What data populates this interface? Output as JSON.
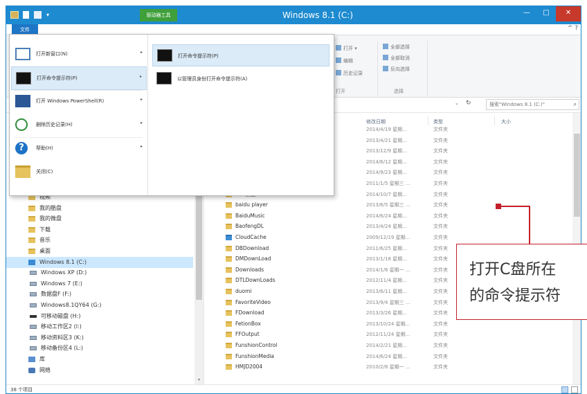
{
  "titlebar": {
    "title": "Windows 8.1 (C:)",
    "contextual_tab": "驱动器工具",
    "qat_more": "▾",
    "minimize": "—",
    "maximize": "□",
    "close": "✕"
  },
  "tabs": {
    "file": "文件",
    "ribbon_controls": "^ ?"
  },
  "ribbon": {
    "open": "打开 ▾",
    "edit": "编辑",
    "history": "历史记录",
    "select_all": "全部选择",
    "select_none": "全部取消",
    "invert": "反向选择",
    "group_open": "打开",
    "group_select": "选择"
  },
  "address": {
    "chevron": "⌄",
    "refresh": "↻",
    "search_placeholder": "搜索\"Windows 8.1 (C:)\"",
    "search_icon": "⌕"
  },
  "file_menu": {
    "items": [
      {
        "label": "打开新窗口(N)",
        "arrow": "▸",
        "icon": "window-icon"
      },
      {
        "label": "打开命令提示符(P)",
        "arrow": "▸",
        "icon": "command-prompt-icon"
      },
      {
        "label": "打开 Windows PowerShell(R)",
        "arrow": "▸",
        "icon": "powershell-icon"
      },
      {
        "label": "删除历史记录(H)",
        "arrow": "▸",
        "icon": "delete-history-icon"
      },
      {
        "label": "帮助(H)",
        "arrow": "▸",
        "icon": "help-icon"
      },
      {
        "label": "关闭(C)",
        "arrow": "",
        "icon": "close-folder-icon"
      }
    ],
    "submenu": [
      {
        "label": "打开命令提示符(P)",
        "icon": "command-prompt-icon"
      },
      {
        "label": "以管理员身份打开命令提示符(A)",
        "icon": "admin-command-prompt-icon"
      }
    ],
    "help_glyph": "?"
  },
  "nav": {
    "items": [
      {
        "label": "视频",
        "icon": "folder-icon"
      },
      {
        "label": "我的酷盘",
        "icon": "folder-icon"
      },
      {
        "label": "我的微盘",
        "icon": "folder-icon"
      },
      {
        "label": "下载",
        "icon": "folder-icon"
      },
      {
        "label": "音乐",
        "icon": "folder-icon"
      },
      {
        "label": "桌面",
        "icon": "folder-icon"
      },
      {
        "label": "Windows 8.1 (C:)",
        "icon": "windows-drive-icon",
        "selected": true
      },
      {
        "label": "Windows XP (D:)",
        "icon": "drive-icon"
      },
      {
        "label": "Windows 7 (E:)",
        "icon": "drive-icon"
      },
      {
        "label": "数据盘F (F:)",
        "icon": "drive-icon"
      },
      {
        "label": "Windows8.1QY64 (G:)",
        "icon": "drive-icon"
      },
      {
        "label": "可移动磁盘 (H:)",
        "icon": "removable-drive-icon"
      },
      {
        "label": "移动工作区2 (I:)",
        "icon": "drive-icon"
      },
      {
        "label": "移动资料区3 (K:)",
        "icon": "drive-icon"
      },
      {
        "label": "移动备份区4 (L:)",
        "icon": "drive-icon"
      },
      {
        "label": "库",
        "icon": "library-icon"
      },
      {
        "label": "网络",
        "icon": "network-icon"
      }
    ],
    "scroll_down": "▾"
  },
  "columns": {
    "modified": "修改日期",
    "type": "类型",
    "size": "大小"
  },
  "files": [
    {
      "name": "",
      "date": "2014/4/19 星期...",
      "type": "文件夹"
    },
    {
      "name": "",
      "date": "2013/4/21 星期...",
      "type": "文件夹"
    },
    {
      "name": "",
      "date": "2013/12/9 星期...",
      "type": "文件夹"
    },
    {
      "name": "",
      "date": "2014/6/12 星期...",
      "type": "文件夹"
    },
    {
      "name": "",
      "date": "2014/9/23 星期...",
      "type": "文件夹"
    },
    {
      "name": "",
      "date": "2011/1/5 星期三 ...",
      "type": "文件夹"
    },
    {
      "name": "360云盘",
      "date": "2014/10/7 星期...",
      "type": "文件夹"
    },
    {
      "name": "baidu player",
      "date": "2013/6/5 星期三 ...",
      "type": "文件夹"
    },
    {
      "name": "BaiduMusic",
      "date": "2014/6/24 星期...",
      "type": "文件夹"
    },
    {
      "name": "BaofengDL",
      "date": "2013/4/24 星期...",
      "type": "文件夹"
    },
    {
      "name": "CloudCache",
      "date": "2009/12/19 星期...",
      "type": "文件夹",
      "blue": true
    },
    {
      "name": "DBDownload",
      "date": "2011/6/25 星期...",
      "type": "文件夹"
    },
    {
      "name": "DMDownLoad",
      "date": "2013/1/18 星期...",
      "type": "文件夹"
    },
    {
      "name": "Downloads",
      "date": "2014/1/6 星期一 ...",
      "type": "文件夹"
    },
    {
      "name": "DTLDownLoads",
      "date": "2012/11/4 星期...",
      "type": "文件夹"
    },
    {
      "name": "duomi",
      "date": "2013/6/11 星期...",
      "type": "文件夹"
    },
    {
      "name": "FavoriteVideo",
      "date": "2013/9/4 星期三 ...",
      "type": "文件夹"
    },
    {
      "name": "FDownload",
      "date": "2013/3/26 星期...",
      "type": "文件夹"
    },
    {
      "name": "FetionBox",
      "date": "2013/10/24 星期...",
      "type": "文件夹"
    },
    {
      "name": "FFOutput",
      "date": "2012/11/24 星期...",
      "type": "文件夹"
    },
    {
      "name": "FunshionControl",
      "date": "2014/2/21 星期...",
      "type": "文件夹"
    },
    {
      "name": "FunshionMedia",
      "date": "2014/6/24 星期...",
      "type": "文件夹"
    },
    {
      "name": "HMJD2004",
      "date": "2010/2/8 星期一 ...",
      "type": "文件夹"
    }
  ],
  "status": {
    "count": "38 个项目"
  },
  "annotation": {
    "line1": "打开C盘所在",
    "line2": "的命令提示符",
    "color": "#c41e2a"
  },
  "colors": {
    "titlebar": "#1e8bd0",
    "file_tab": "#1e76c6",
    "contextual_tab": "#3f9f3a",
    "selection": "#cce8ff"
  }
}
